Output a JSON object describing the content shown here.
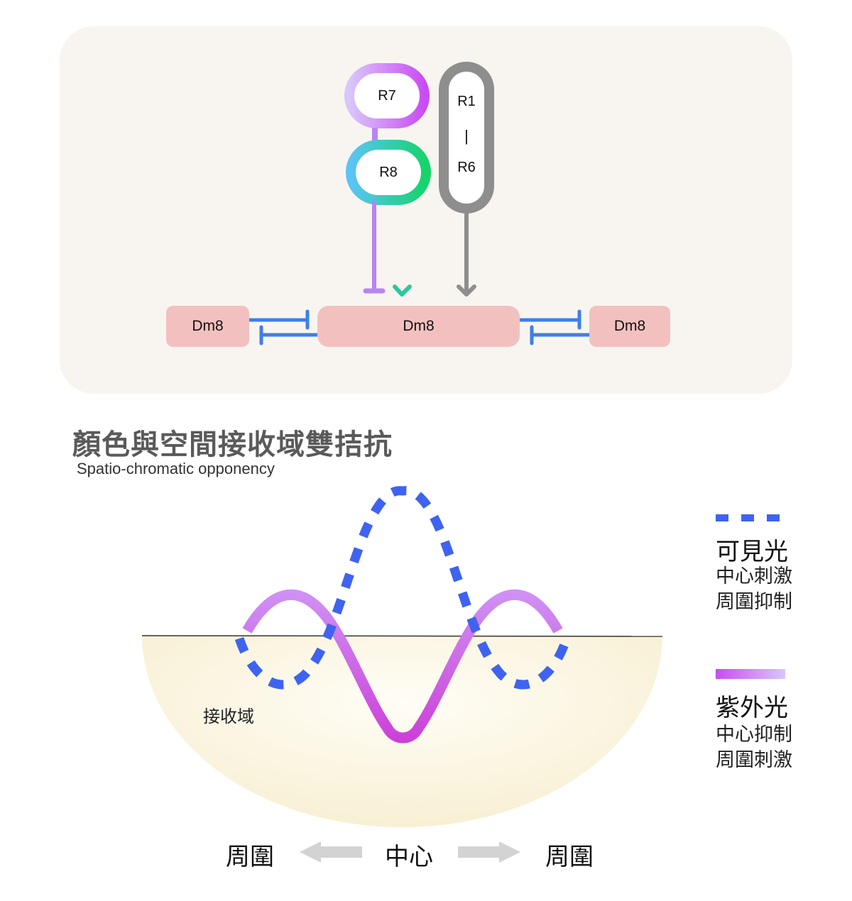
{
  "diagram": {
    "circuit": {
      "photoreceptors": [
        {
          "id": "r7",
          "label": "R7",
          "gradient": [
            "#d9c6fb",
            "#c94cf2"
          ]
        },
        {
          "id": "r8",
          "label": "R8",
          "gradient": [
            "#5bc4f5",
            "#14d46a"
          ]
        },
        {
          "id": "r1r6",
          "label_top": "R1",
          "label_sep": "|",
          "label_bottom": "R6",
          "color": "#8e8e8e"
        }
      ],
      "connections": [
        {
          "from": "R7",
          "to": "Dm8 (center)",
          "type": "inhibitory",
          "color": "#b983f5"
        },
        {
          "from": "R8",
          "to": "Dm8 (center)",
          "type": "excitatory",
          "gradient": [
            "#5bc4f5",
            "#14d46a"
          ]
        },
        {
          "from": "R1-R6",
          "to": "Dm8 (center)",
          "type": "excitatory",
          "color": "#8e8e8e"
        },
        {
          "from": "Dm8 (left)",
          "to": "Dm8 (center)",
          "type": "inhibitory",
          "color": "#3f7fe6"
        },
        {
          "from": "Dm8 (center)",
          "to": "Dm8 (left)",
          "type": "inhibitory",
          "color": "#3f7fe6"
        },
        {
          "from": "Dm8 (center)",
          "to": "Dm8 (right)",
          "type": "inhibitory",
          "color": "#3f7fe6"
        },
        {
          "from": "Dm8 (right)",
          "to": "Dm8 (center)",
          "type": "inhibitory",
          "color": "#3f7fe6"
        }
      ],
      "dm8_cells": [
        {
          "id": "dm8-left",
          "label": "Dm8"
        },
        {
          "id": "dm8-center",
          "label": "Dm8"
        },
        {
          "id": "dm8-right",
          "label": "Dm8"
        }
      ],
      "dm8_color": "#f2c1bf",
      "panel_color": "#f8f5f0"
    },
    "title": {
      "zh": "顏色與空間接收域雙拮抗",
      "en": "Spatio-chromatic opponency"
    },
    "receptive_field": {
      "label": "接收域",
      "fill_center": "#fffdf6",
      "fill_edge": "#f8f0d4",
      "curves": [
        {
          "name": "visible",
          "style": "dashed",
          "color": "#3f63f0",
          "profile": "center-excitation, surround-inhibition"
        },
        {
          "name": "uv",
          "style": "solid",
          "gradient": [
            "#cf93f5",
            "#cc3fd8"
          ],
          "profile": "center-inhibition, surround-excitation"
        }
      ]
    },
    "legend": [
      {
        "id": "visible",
        "title": "可見光",
        "line1": "中心刺激",
        "line2": "周圍抑制",
        "swatch": "dashed",
        "color": "#3f63f0"
      },
      {
        "id": "uv",
        "title": "紫外光",
        "line1": "中心抑制",
        "line2": "周圍刺激",
        "swatch": "gradient",
        "gradient": [
          "#c94cf2",
          "#d9c6fb"
        ]
      }
    ],
    "axis": {
      "left": "周圍",
      "center": "中心",
      "right": "周圍",
      "arrow_color": "#d3d3d3"
    }
  }
}
